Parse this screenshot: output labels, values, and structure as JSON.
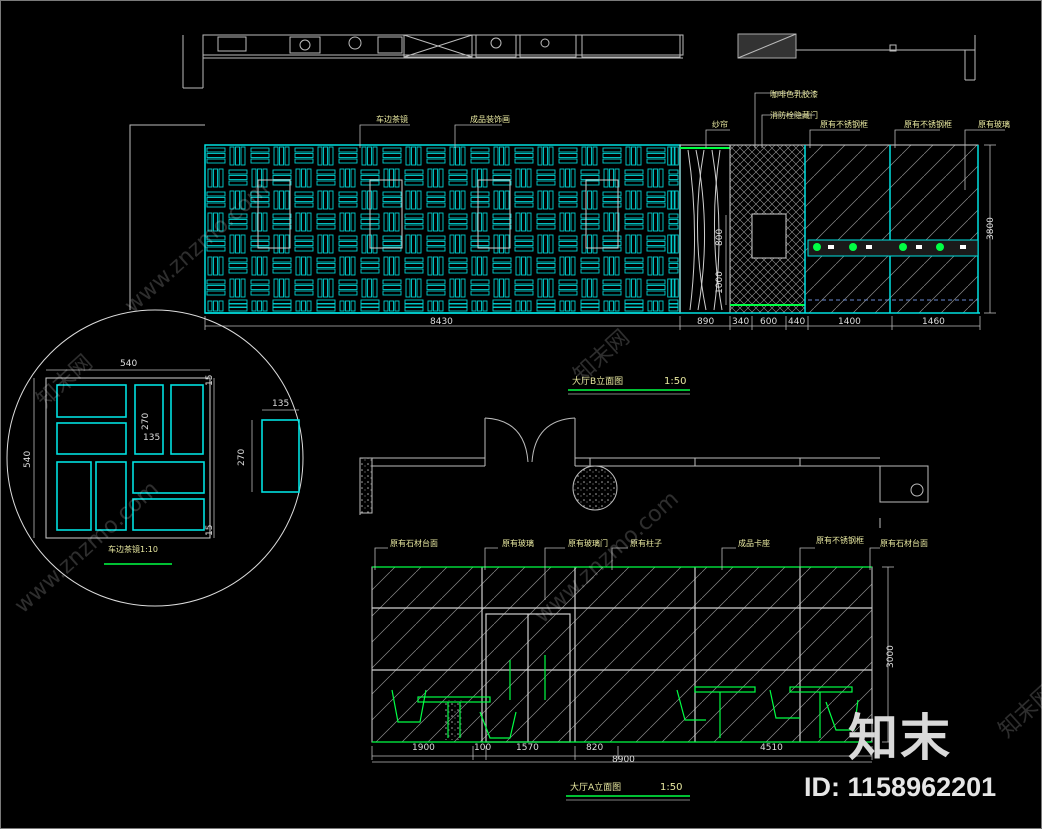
{
  "elevation_b": {
    "title": "大厅B立面图",
    "scale": "1:50",
    "labels": [
      "车边茶镜",
      "成品装饰画",
      "纱帘",
      "咖啡色乳胶漆",
      "消防栓隐藏门",
      "原有不锈钢框",
      "原有不锈钢框",
      "原有玻璃"
    ],
    "dims_bottom": [
      "8430",
      "890",
      "340",
      "600",
      "440",
      "1400",
      "1460"
    ],
    "dims_side": [
      "800",
      "1000"
    ],
    "height": "3800"
  },
  "detail": {
    "title": "车边茶镜1:10",
    "dims": [
      "540",
      "540",
      "270",
      "135",
      "135",
      "135",
      "270",
      "15",
      "15"
    ]
  },
  "elevation_a": {
    "title": "大厅A立面图",
    "scale": "1:50",
    "labels": [
      "原有石材台面",
      "原有玻璃",
      "原有玻璃门",
      "原有柱子",
      "成品卡座",
      "原有不锈钢框",
      "原有石材台面"
    ],
    "dims_bottom": [
      "1900",
      "100",
      "1570",
      "820",
      "4510"
    ],
    "total": "8900",
    "height": "3000"
  },
  "watermark": {
    "logo": "知末",
    "id": "ID: 1158962201",
    "site": "www.znzmo.com",
    "brand": "知末网"
  },
  "colors": {
    "cyan": "#00e0e0",
    "green": "#00ff44",
    "white": "#ffffff",
    "yellow": "#e8e8a0",
    "grey": "#9a9a9a"
  }
}
